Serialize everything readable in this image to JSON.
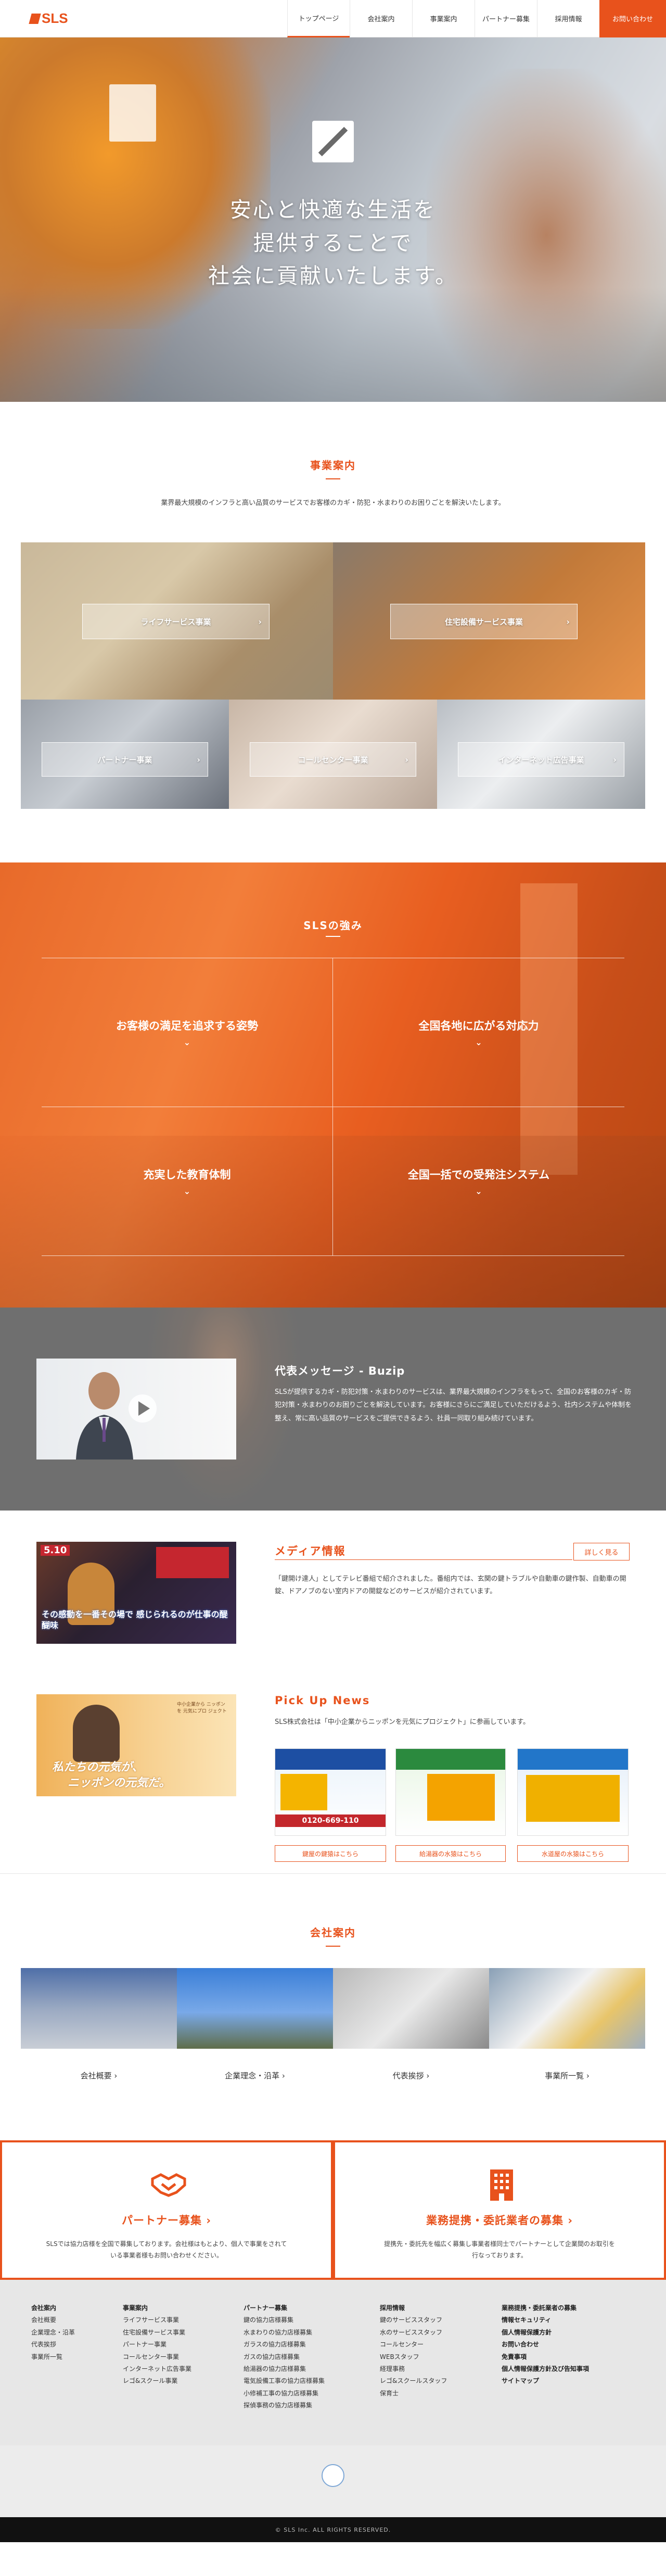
{
  "header": {
    "logo_text": "SLS",
    "nav": [
      "トップページ",
      "会社案内",
      "事業案内",
      "パートナー募集",
      "採用情報"
    ],
    "contact": "お問い合わせ"
  },
  "hero": {
    "line1": "安心と快適な生活を",
    "line2": "提供することで",
    "line3": "社会に貢献いたします。"
  },
  "business": {
    "title": "事業案内",
    "lead": "業界最大規模のインフラと高い品質のサービスでお客様のカギ・防犯・水まわりのお困りごとを解決いたします。",
    "items": [
      "ライフサービス事業",
      "住宅設備サービス事業",
      "パートナー事業",
      "コールセンター事業",
      "インターネット広告事業"
    ]
  },
  "strengths": {
    "title": "SLSの強み",
    "items": [
      "お客様の満足を追求する姿勢",
      "全国各地に広がる対応力",
      "充実した教育体制",
      "全国一括での受発注システム"
    ]
  },
  "message": {
    "title": "代表メッセージ - Buzip",
    "body": "SLSが提供するカギ・防犯対策・水まわりのサービスは、業界最大規模のインフラをもって、全国のお客様のカギ・防犯対策・水まわりのお困りごとを解決しています。お客様にさらにご満足していただけるよう、社内システムや体制を整え、常に高い品質のサービスをご提供できるよう、社員一同取り組み続けています。"
  },
  "media": {
    "title": "メディア情報",
    "more": "詳しく見る",
    "body": "「鍵開け達人」としてテレビ番組で紹介されました。番組内では、玄関の鍵トラブルや自動車の鍵作製、自動車の開錠、ドアノブのない室内ドアの開錠などのサービスが紹介されています。",
    "thumb_caption": "その感動を一番その場で 感じられるのが仕事の醍醐味",
    "thumb_badge": "5.10"
  },
  "pickup": {
    "title": "Pick Up News",
    "body": "SLS株式会社は「中小企業からニッポンを元気にプロジェクト」に参画しています。",
    "thumb_caption1": "私たちの元気が、",
    "thumb_caption2": "ニッポンの元気だ。",
    "thumb_side": "中小企業から ニッポンを 元気にプロ ジェクト",
    "ads": [
      "0120-669-110",
      "",
      ""
    ],
    "buttons": [
      "鍵屋の鍵猿はこちら",
      "給湯器の水猿はこちら",
      "水道屋の水猿はこちら"
    ]
  },
  "company": {
    "title": "会社案内",
    "items": [
      "会社概要",
      "企業理念・沿革",
      "代表挨拶",
      "事業所一覧"
    ]
  },
  "recruit": {
    "partner_title": "パートナー募集",
    "partner_desc": "SLSでは協力店様を全国で募集しております。会社様はもとより、個人で事業をされている事業者様もお問い合わせください。",
    "business_title": "業務提携・委託業者の募集",
    "business_desc": "提携先・委託先を幅広く募集し事業者様同士でパートナーとして企業間のお取引を行なっております。"
  },
  "footer": {
    "col1": [
      "会社案内",
      "会社概要",
      "企業理念・沿革",
      "代表挨拶",
      "事業所一覧"
    ],
    "col2": [
      "事業案内",
      "ライフサービス事業",
      "住宅設備サービス事業",
      "パートナー事業",
      "コールセンター事業",
      "インターネット広告事業",
      "レゴ&スクール事業"
    ],
    "col3": [
      "パートナー募集",
      "鍵の協力店様募集",
      "水まわりの協力店様募集",
      "ガラスの協力店様募集",
      "ガスの協力店様募集",
      "給湯器の協力店様募集",
      "電気設備工事の協力店様募集",
      "小修補工事の協力店様募集",
      "探偵事務の協力店様募集"
    ],
    "col4": [
      "採用情報",
      "鍵のサービススタッフ",
      "水のサービススタッフ",
      "コールセンター",
      "WEBスタッフ",
      "経理事務",
      "レゴ&スクールスタッフ",
      "保育士"
    ],
    "col5": [
      "業務提携・委託業者の募集",
      "情報セキュリティ",
      "個人情報保護方針",
      "お問い合わせ",
      "免責事項",
      "個人情報保護方針及び告知事項",
      "サイトマップ"
    ],
    "copyright": "© SLS Inc. ALL RIGHTS RESERVED."
  },
  "colors": {
    "accent": "#e8521c",
    "footer_bg": "#e7e7e7"
  }
}
